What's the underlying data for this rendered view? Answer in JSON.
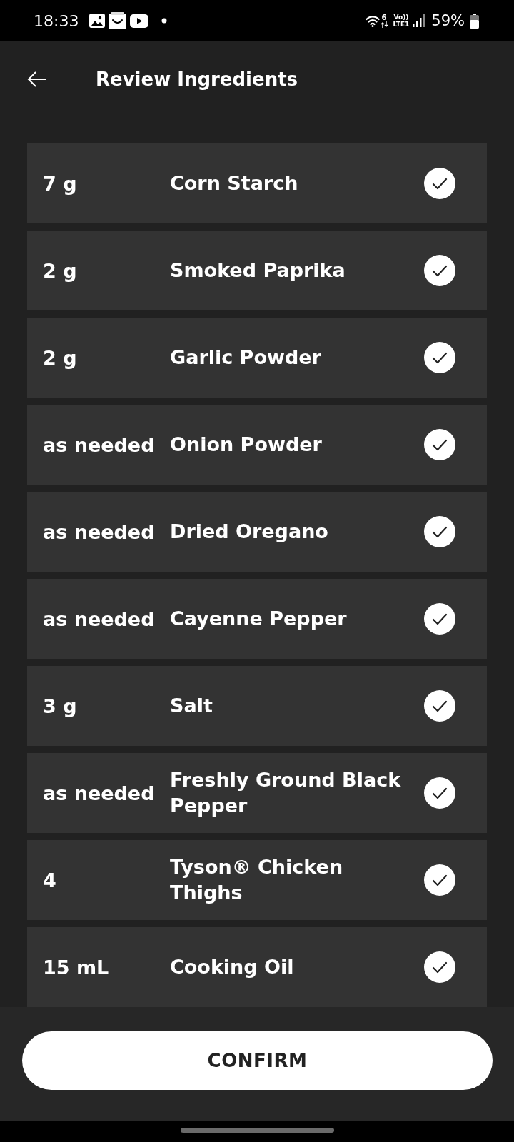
{
  "status_bar": {
    "time": "18:33",
    "wifi_badge": "6",
    "network_label": [
      "Vo))",
      "LTE1"
    ],
    "battery": "59%"
  },
  "header": {
    "title": "Review Ingredients"
  },
  "ingredients": [
    {
      "quantity": "7 g",
      "name": "Corn Starch",
      "checked": true
    },
    {
      "quantity": "2 g",
      "name": "Smoked Paprika",
      "checked": true
    },
    {
      "quantity": "2 g",
      "name": "Garlic Powder",
      "checked": true
    },
    {
      "quantity": "as needed",
      "name": "Onion Powder",
      "checked": true
    },
    {
      "quantity": "as needed",
      "name": "Dried Oregano",
      "checked": true
    },
    {
      "quantity": "as needed",
      "name": "Cayenne Pepper",
      "checked": true
    },
    {
      "quantity": "3 g",
      "name": "Salt",
      "checked": true
    },
    {
      "quantity": "as needed",
      "name": "Freshly Ground Black Pepper",
      "checked": true
    },
    {
      "quantity": "4",
      "name": "Tyson® Chicken Thighs",
      "checked": true
    },
    {
      "quantity": "15 mL",
      "name": "Cooking Oil",
      "checked": true
    }
  ],
  "confirm_button": {
    "label": "CONFIRM"
  }
}
